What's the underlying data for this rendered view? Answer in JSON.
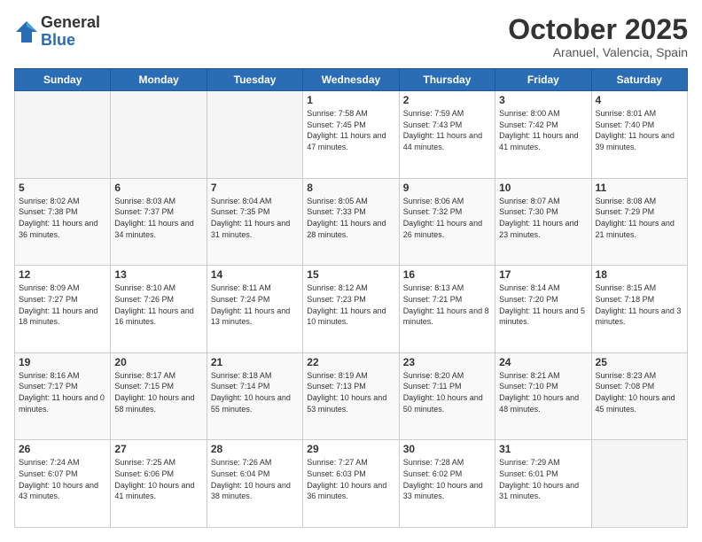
{
  "logo": {
    "general": "General",
    "blue": "Blue"
  },
  "header": {
    "month": "October 2025",
    "location": "Aranuel, Valencia, Spain"
  },
  "weekdays": [
    "Sunday",
    "Monday",
    "Tuesday",
    "Wednesday",
    "Thursday",
    "Friday",
    "Saturday"
  ],
  "weeks": [
    [
      {
        "day": "",
        "info": ""
      },
      {
        "day": "",
        "info": ""
      },
      {
        "day": "",
        "info": ""
      },
      {
        "day": "1",
        "info": "Sunrise: 7:58 AM\nSunset: 7:45 PM\nDaylight: 11 hours and 47 minutes."
      },
      {
        "day": "2",
        "info": "Sunrise: 7:59 AM\nSunset: 7:43 PM\nDaylight: 11 hours and 44 minutes."
      },
      {
        "day": "3",
        "info": "Sunrise: 8:00 AM\nSunset: 7:42 PM\nDaylight: 11 hours and 41 minutes."
      },
      {
        "day": "4",
        "info": "Sunrise: 8:01 AM\nSunset: 7:40 PM\nDaylight: 11 hours and 39 minutes."
      }
    ],
    [
      {
        "day": "5",
        "info": "Sunrise: 8:02 AM\nSunset: 7:38 PM\nDaylight: 11 hours and 36 minutes."
      },
      {
        "day": "6",
        "info": "Sunrise: 8:03 AM\nSunset: 7:37 PM\nDaylight: 11 hours and 34 minutes."
      },
      {
        "day": "7",
        "info": "Sunrise: 8:04 AM\nSunset: 7:35 PM\nDaylight: 11 hours and 31 minutes."
      },
      {
        "day": "8",
        "info": "Sunrise: 8:05 AM\nSunset: 7:33 PM\nDaylight: 11 hours and 28 minutes."
      },
      {
        "day": "9",
        "info": "Sunrise: 8:06 AM\nSunset: 7:32 PM\nDaylight: 11 hours and 26 minutes."
      },
      {
        "day": "10",
        "info": "Sunrise: 8:07 AM\nSunset: 7:30 PM\nDaylight: 11 hours and 23 minutes."
      },
      {
        "day": "11",
        "info": "Sunrise: 8:08 AM\nSunset: 7:29 PM\nDaylight: 11 hours and 21 minutes."
      }
    ],
    [
      {
        "day": "12",
        "info": "Sunrise: 8:09 AM\nSunset: 7:27 PM\nDaylight: 11 hours and 18 minutes."
      },
      {
        "day": "13",
        "info": "Sunrise: 8:10 AM\nSunset: 7:26 PM\nDaylight: 11 hours and 16 minutes."
      },
      {
        "day": "14",
        "info": "Sunrise: 8:11 AM\nSunset: 7:24 PM\nDaylight: 11 hours and 13 minutes."
      },
      {
        "day": "15",
        "info": "Sunrise: 8:12 AM\nSunset: 7:23 PM\nDaylight: 11 hours and 10 minutes."
      },
      {
        "day": "16",
        "info": "Sunrise: 8:13 AM\nSunset: 7:21 PM\nDaylight: 11 hours and 8 minutes."
      },
      {
        "day": "17",
        "info": "Sunrise: 8:14 AM\nSunset: 7:20 PM\nDaylight: 11 hours and 5 minutes."
      },
      {
        "day": "18",
        "info": "Sunrise: 8:15 AM\nSunset: 7:18 PM\nDaylight: 11 hours and 3 minutes."
      }
    ],
    [
      {
        "day": "19",
        "info": "Sunrise: 8:16 AM\nSunset: 7:17 PM\nDaylight: 11 hours and 0 minutes."
      },
      {
        "day": "20",
        "info": "Sunrise: 8:17 AM\nSunset: 7:15 PM\nDaylight: 10 hours and 58 minutes."
      },
      {
        "day": "21",
        "info": "Sunrise: 8:18 AM\nSunset: 7:14 PM\nDaylight: 10 hours and 55 minutes."
      },
      {
        "day": "22",
        "info": "Sunrise: 8:19 AM\nSunset: 7:13 PM\nDaylight: 10 hours and 53 minutes."
      },
      {
        "day": "23",
        "info": "Sunrise: 8:20 AM\nSunset: 7:11 PM\nDaylight: 10 hours and 50 minutes."
      },
      {
        "day": "24",
        "info": "Sunrise: 8:21 AM\nSunset: 7:10 PM\nDaylight: 10 hours and 48 minutes."
      },
      {
        "day": "25",
        "info": "Sunrise: 8:23 AM\nSunset: 7:08 PM\nDaylight: 10 hours and 45 minutes."
      }
    ],
    [
      {
        "day": "26",
        "info": "Sunrise: 7:24 AM\nSunset: 6:07 PM\nDaylight: 10 hours and 43 minutes."
      },
      {
        "day": "27",
        "info": "Sunrise: 7:25 AM\nSunset: 6:06 PM\nDaylight: 10 hours and 41 minutes."
      },
      {
        "day": "28",
        "info": "Sunrise: 7:26 AM\nSunset: 6:04 PM\nDaylight: 10 hours and 38 minutes."
      },
      {
        "day": "29",
        "info": "Sunrise: 7:27 AM\nSunset: 6:03 PM\nDaylight: 10 hours and 36 minutes."
      },
      {
        "day": "30",
        "info": "Sunrise: 7:28 AM\nSunset: 6:02 PM\nDaylight: 10 hours and 33 minutes."
      },
      {
        "day": "31",
        "info": "Sunrise: 7:29 AM\nSunset: 6:01 PM\nDaylight: 10 hours and 31 minutes."
      },
      {
        "day": "",
        "info": ""
      }
    ]
  ]
}
